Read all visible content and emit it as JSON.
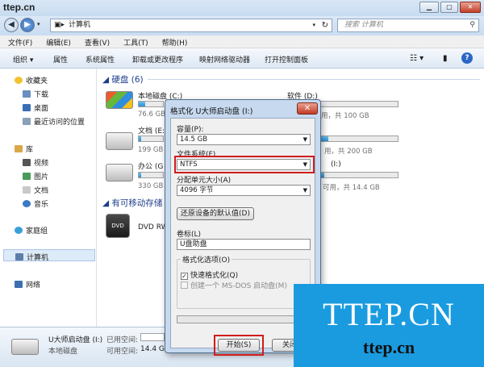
{
  "window": {
    "watermark": "ttep.cn"
  },
  "address": {
    "path": "计算机",
    "search_placeholder": "搜索 计算机"
  },
  "menu": [
    "文件(F)",
    "编辑(E)",
    "查看(V)",
    "工具(T)",
    "帮助(H)"
  ],
  "commands": [
    "组织 ▾",
    "属性",
    "系统属性",
    "卸载或更改程序",
    "映射网络驱动器",
    "打开控制面板"
  ],
  "nav": {
    "favorites": "收藏夹",
    "downloads": "下载",
    "desktop": "桌面",
    "recent": "最近访问的位置",
    "libraries": "库",
    "videos": "视频",
    "pictures": "图片",
    "documents": "文档",
    "music": "音乐",
    "homegroup": "家庭组",
    "computer": "计算机",
    "network": "网络"
  },
  "groups": {
    "hdd": "硬盘 (6)",
    "removable": "有可移动存储"
  },
  "drives": [
    {
      "name": "本地磁盘 (C:)",
      "size": "76.6 GB",
      "fill": 0.25
    },
    {
      "name": "软件 (D:)",
      "size": "用，共 100 GB",
      "fill": 0.1
    },
    {
      "name": "文档 (E:",
      "size": "199 GB",
      "fill": 0.1
    },
    {
      "name": "",
      "size": "用，共 200 GB",
      "fill": 0.1
    },
    {
      "name": "办公 (G",
      "size": "330 GB",
      "fill": 0.1
    },
    {
      "name": "(I:)",
      "size": "可用，共 14.4 GB",
      "fill": 0.05
    }
  ],
  "dvd": {
    "name": "DVD RW"
  },
  "details": {
    "name": "U大师启动盘 (I:)",
    "type": "本地磁盘",
    "used_label": "已用空间:",
    "free_label": "可用空间:",
    "free_value": "14.4 GB"
  },
  "dialog": {
    "title": "格式化 U大师启动盘 (I:)",
    "close": "✕",
    "capacity_label": "容量(P):",
    "capacity_value": "14.5 GB",
    "fs_label": "文件系统(F)",
    "fs_value": "NTFS",
    "alloc_label": "分配单元大小(A)",
    "alloc_value": "4096 字节",
    "restore_btn": "还原设备的默认值(D)",
    "volume_label": "卷标(L)",
    "volume_value": "U盘助盘",
    "options_label": "格式化选项(O)",
    "quick_format": "快速格式化(Q)",
    "msdos": "创建一个 MS-DOS 启动盘(M)",
    "start_btn": "开始(S)",
    "close_btn": "关闭"
  },
  "logo": {
    "line1": "TTEP.CN",
    "line2": "ttep.cn"
  },
  "colors": {
    "highlight": "#d01c1c",
    "logo_bg": "#1a9be0"
  }
}
